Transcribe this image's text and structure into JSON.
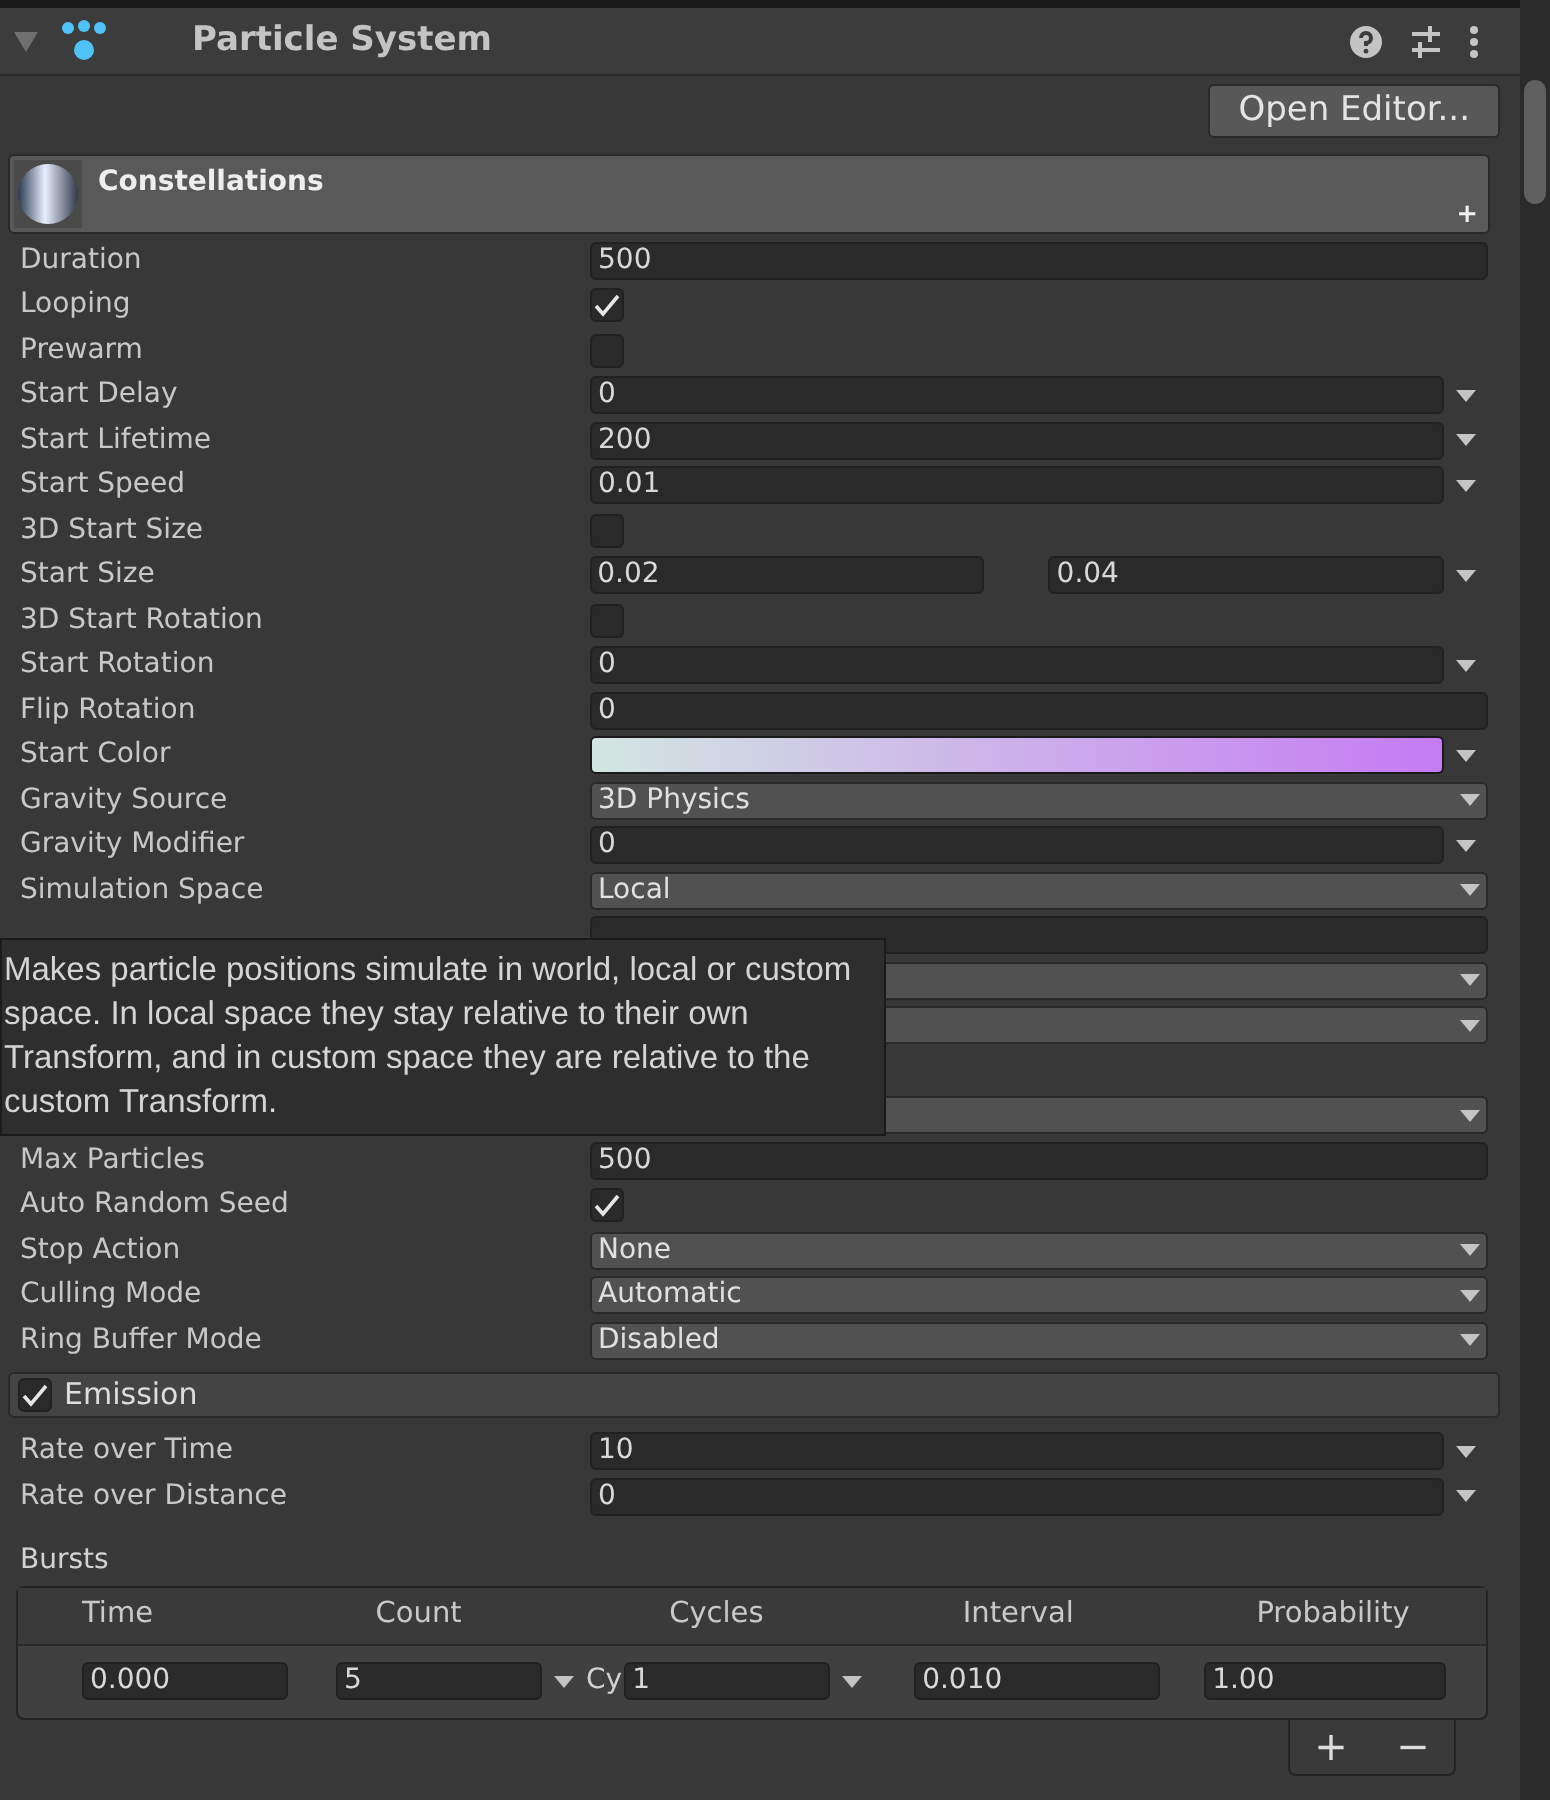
{
  "header": {
    "title": "Particle System",
    "expanded": true
  },
  "open_editor": "Open Editor...",
  "module": {
    "title": "Constellations",
    "add": "+"
  },
  "rows": [
    {
      "kind": "text",
      "label": "Duration",
      "value": "500"
    },
    {
      "kind": "check",
      "label": "Looping",
      "checked": true
    },
    {
      "kind": "check",
      "label": "Prewarm",
      "checked": false
    },
    {
      "kind": "curve",
      "label": "Start Delay",
      "value": "0"
    },
    {
      "kind": "curve",
      "label": "Start Lifetime",
      "value": "200"
    },
    {
      "kind": "curve",
      "label": "Start Speed",
      "value": "0.01"
    },
    {
      "kind": "check",
      "label": "3D Start Size",
      "checked": false
    },
    {
      "kind": "range",
      "label": "Start Size",
      "value": "0.02",
      "value2": "0.04"
    },
    {
      "kind": "check",
      "label": "3D Start Rotation",
      "checked": false
    },
    {
      "kind": "curve",
      "label": "Start Rotation",
      "value": "0"
    },
    {
      "kind": "text",
      "label": "Flip Rotation",
      "value": "0"
    },
    {
      "kind": "gradient",
      "label": "Start Color",
      "gradient": [
        {
          "color": "#d2e6e1"
        },
        {
          "color": "#c67af3"
        }
      ]
    },
    {
      "kind": "dropdown",
      "label": "Gravity Source",
      "value": "3D Physics"
    },
    {
      "kind": "curve",
      "label": "Gravity Modifier",
      "value": "0"
    },
    {
      "kind": "dropdown",
      "label": "Simulation Space",
      "value": "Local"
    },
    {
      "kind": "text"
    },
    {
      "kind": "dropdown"
    },
    {
      "kind": "dropdown"
    },
    {
      "kind": "blank"
    },
    {
      "kind": "dropdown"
    },
    {
      "kind": "text",
      "label": "Max Particles",
      "value": "500"
    },
    {
      "kind": "check",
      "label": "Auto Random Seed",
      "checked": true
    },
    {
      "kind": "dropdown",
      "label": "Stop Action",
      "value": "None"
    },
    {
      "kind": "dropdown",
      "label": "Culling Mode",
      "value": "Automatic"
    },
    {
      "kind": "dropdown",
      "label": "Ring Buffer Mode",
      "value": "Disabled"
    }
  ],
  "tooltip": "Makes particle positions simulate in world, local or custom space. In local space they stay relative to their own Transform, and in custom space they are relative to the custom Transform.",
  "emission": {
    "label": "Emission",
    "checked": true,
    "rows": [
      {
        "kind": "curve",
        "label": "Rate over Time",
        "value": "10"
      },
      {
        "kind": "curve",
        "label": "Rate over Distance",
        "value": "0"
      }
    ]
  },
  "bursts": {
    "label": "Bursts",
    "columns": [
      "Time",
      "Count",
      "Cycles",
      "Interval",
      "Probability"
    ],
    "rows": [
      {
        "time": "0.000",
        "count": "5",
        "cycles_prefix": "Cy",
        "cycles": "1",
        "interval": "0.010",
        "probability": "1.00"
      }
    ],
    "buttons": [
      "+",
      "−"
    ]
  }
}
